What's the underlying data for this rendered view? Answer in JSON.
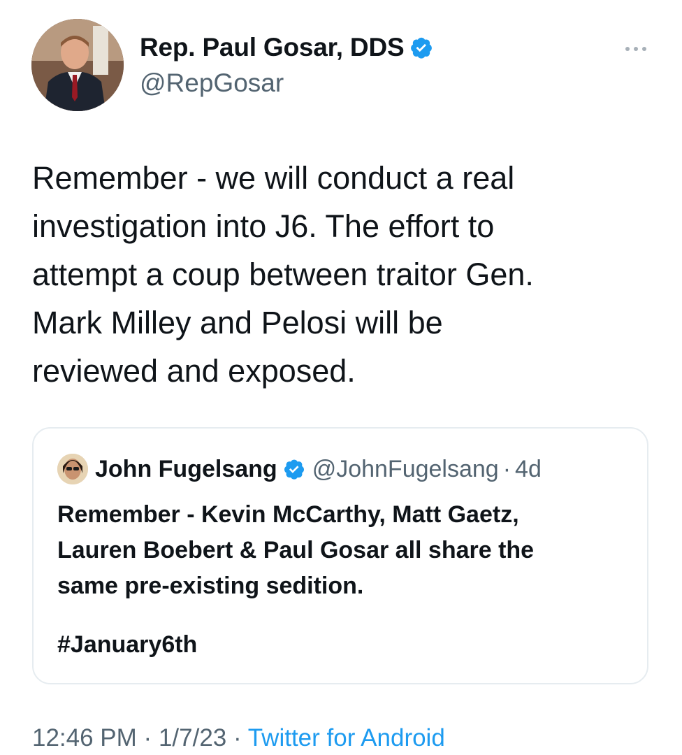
{
  "author": {
    "name": "Rep. Paul Gosar, DDS",
    "handle": "@RepGosar",
    "verified_color": "#1d9bf0"
  },
  "tweet": {
    "text": "Remember - we will conduct a real\ninvestigation into J6. The effort to\nattempt a coup between traitor Gen.\nMark Milley and Pelosi will be\nreviewed and exposed."
  },
  "quoted_tweet": {
    "name": "John Fugelsang",
    "handle": "@JohnFugelsang",
    "separator": "·",
    "time": "4d",
    "text": "Remember - Kevin McCarthy, Matt Gaetz,\nLauren Boebert & Paul Gosar all share the\nsame pre-existing sedition.",
    "hashtag": "#January6th"
  },
  "meta": {
    "time": "12:46 PM",
    "separator1": "·",
    "date": "1/7/23",
    "separator2": "·",
    "source": "Twitter for Android"
  },
  "icons": {
    "more": "more-horizontal-icon",
    "verified": "verified-badge-icon"
  }
}
